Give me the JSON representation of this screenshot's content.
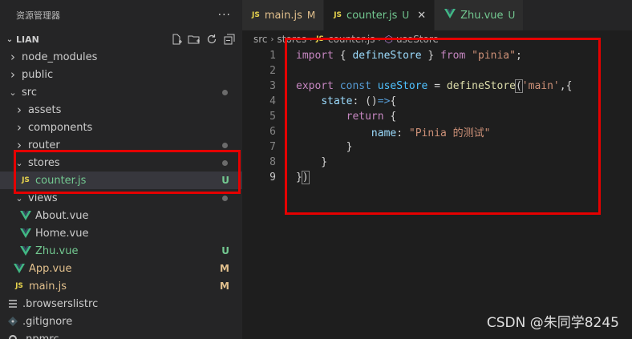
{
  "sidebar": {
    "title": "资源管理器",
    "more": "···",
    "section": "LIAN",
    "items": [
      {
        "label": "node_modules",
        "kind": "folder",
        "depth": 0,
        "open": false,
        "status": ""
      },
      {
        "label": "public",
        "kind": "folder",
        "depth": 0,
        "open": false,
        "status": ""
      },
      {
        "label": "src",
        "kind": "folder",
        "depth": 0,
        "open": true,
        "status": "dot"
      },
      {
        "label": "assets",
        "kind": "folder",
        "depth": 1,
        "open": false,
        "status": ""
      },
      {
        "label": "components",
        "kind": "folder",
        "depth": 1,
        "open": false,
        "status": ""
      },
      {
        "label": "router",
        "kind": "folder",
        "depth": 1,
        "open": false,
        "status": "dot"
      },
      {
        "label": "stores",
        "kind": "folder",
        "depth": 1,
        "open": true,
        "status": "dot"
      },
      {
        "label": "counter.js",
        "kind": "js",
        "depth": 2,
        "status": "U"
      },
      {
        "label": "views",
        "kind": "folder",
        "depth": 1,
        "open": true,
        "status": "dot"
      },
      {
        "label": "About.vue",
        "kind": "vue",
        "depth": 2,
        "status": ""
      },
      {
        "label": "Home.vue",
        "kind": "vue",
        "depth": 2,
        "status": ""
      },
      {
        "label": "Zhu.vue",
        "kind": "vue",
        "depth": 2,
        "status": "U"
      },
      {
        "label": "App.vue",
        "kind": "vue",
        "depth": 1,
        "status": "M"
      },
      {
        "label": "main.js",
        "kind": "js",
        "depth": 1,
        "status": "M"
      },
      {
        "label": ".browserslistrc",
        "kind": "lines",
        "depth": 0,
        "status": ""
      },
      {
        "label": ".gitignore",
        "kind": "git",
        "depth": 0,
        "status": ""
      },
      {
        "label": ".npmrc",
        "kind": "gear",
        "depth": 0,
        "status": ""
      }
    ]
  },
  "tabs": [
    {
      "label": "main.js",
      "icon": "JS",
      "status": "M",
      "active": false
    },
    {
      "label": "counter.js",
      "icon": "JS",
      "status": "U",
      "active": true,
      "close": "✕"
    },
    {
      "label": "Zhu.vue",
      "icon": "vue",
      "status": "U",
      "active": false
    }
  ],
  "breadcrumb": [
    "src",
    "stores",
    "counter.js",
    "useStore"
  ],
  "breadcrumb_icon": "JS",
  "code_lines": [
    "1",
    "2",
    "3",
    "4",
    "5",
    "6",
    "7",
    "8",
    "9"
  ],
  "watermark": "CSDN @朱同学8245",
  "colors": {
    "accent_red": "#e50000",
    "untracked": "#73c991",
    "modified": "#e2c08d",
    "js_yellow": "#e8d44d",
    "vue_green": "#41b883"
  }
}
